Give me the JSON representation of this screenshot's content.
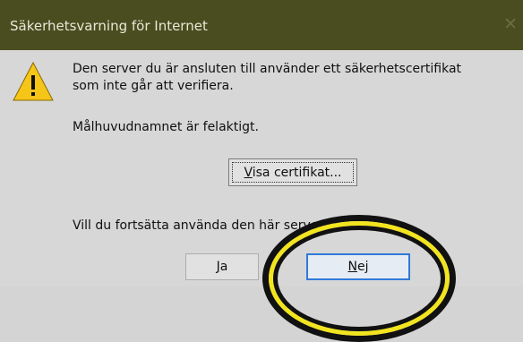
{
  "dialog": {
    "title": "Säkerhetsvarning för Internet",
    "close_glyph": "✕",
    "icon": "warning-icon",
    "message_line1": "Den server du är ansluten till använder ett säkerhetscertifikat",
    "message_line2": "som inte går att verifiera.",
    "detail": "Målhuvudnamnet är felaktigt.",
    "question": "Vill du fortsätta använda den här servern?",
    "view_cert": {
      "first": "V",
      "rest": "isa certifikat..."
    },
    "yes": {
      "first": "J",
      "rest": "a"
    },
    "no": {
      "first": "N",
      "rest": "ej"
    }
  },
  "colors": {
    "titlebar": "#4a4d1f",
    "highlight_ring": "#f2e41e",
    "default_button_border": "#2f7ad8"
  }
}
